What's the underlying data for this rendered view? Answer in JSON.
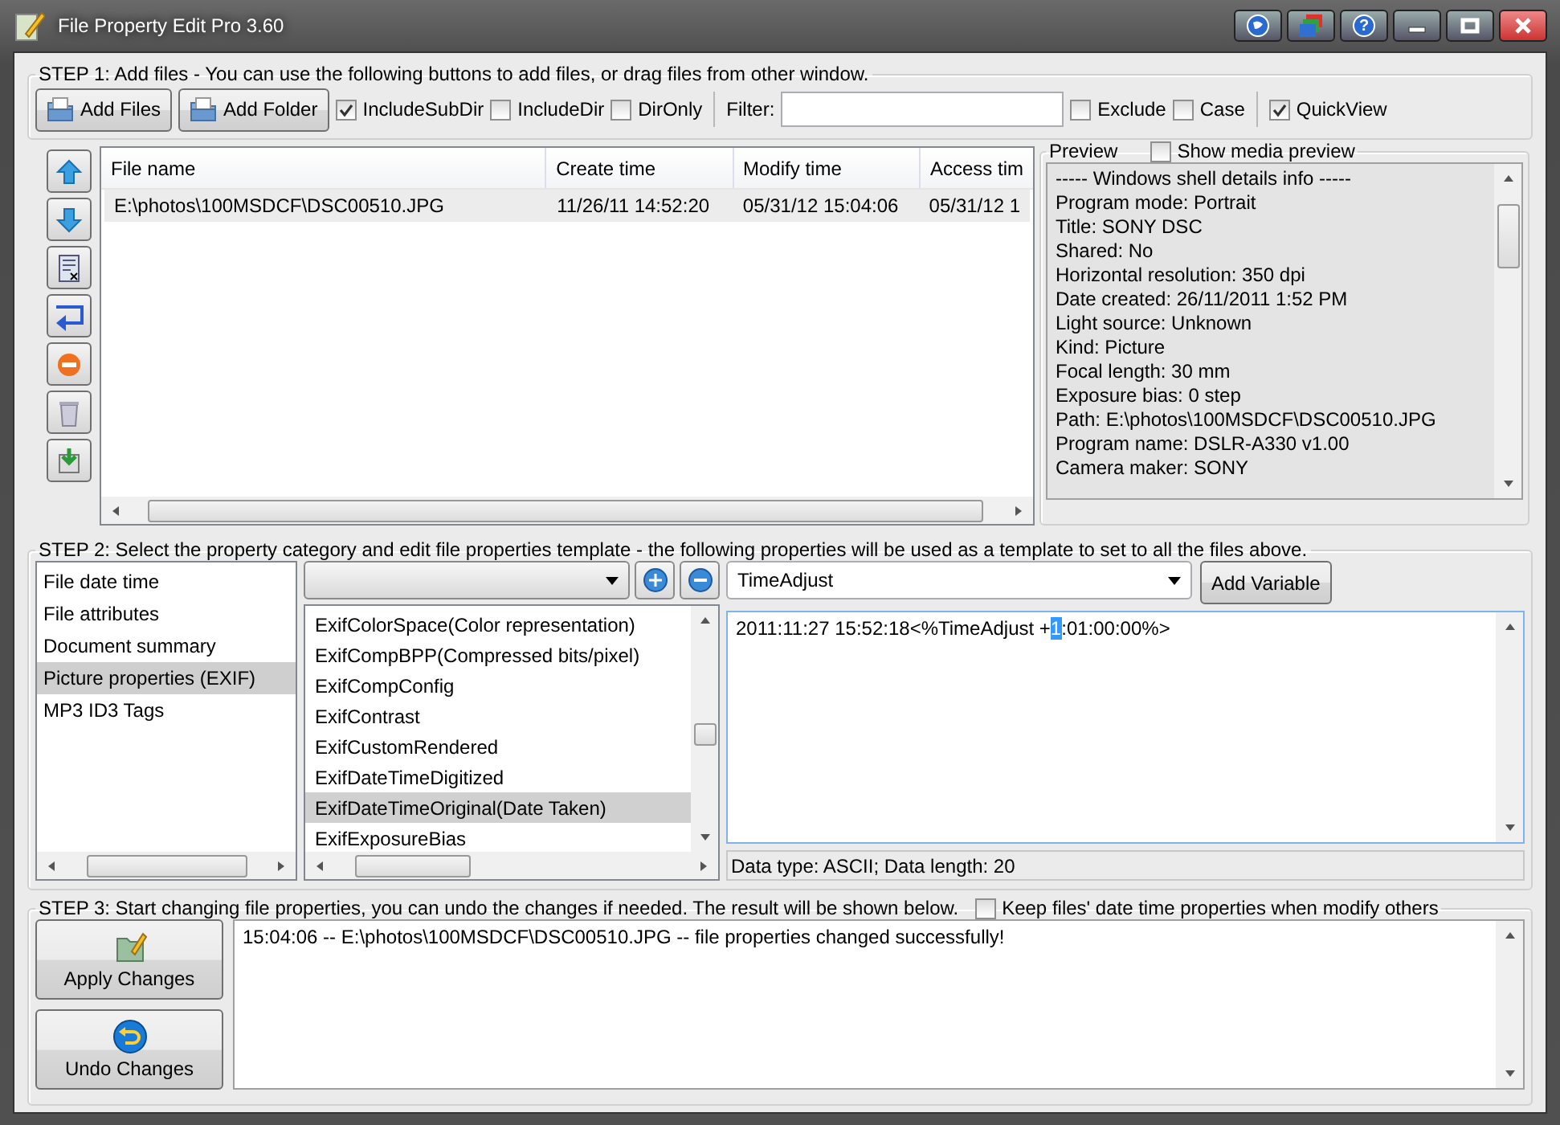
{
  "window": {
    "title": "File Property Edit Pro 3.60",
    "help_glyph": "?"
  },
  "step1": {
    "legend": "STEP 1: Add files - You can use the following buttons to add files, or drag files from other window.",
    "buttons": [
      "Add Files",
      "Add Folder"
    ],
    "options": [
      {
        "label": "IncludeSubDir",
        "checked": true
      },
      {
        "label": "IncludeDir",
        "checked": false
      },
      {
        "label": "DirOnly",
        "checked": false
      }
    ],
    "filter": {
      "label": "Filter:"
    },
    "filter_options": [
      {
        "label": "Exclude",
        "checked": false
      },
      {
        "label": "Case",
        "checked": false
      }
    ],
    "quickview": {
      "label": "QuickView",
      "checked": true
    }
  },
  "files": {
    "columns": [
      "File name",
      "Create time",
      "Modify time",
      "Access tim"
    ],
    "rows": [
      {
        "cells": [
          "E:\\photos\\100MSDCF\\DSC00510.JPG",
          "11/26/11 14:52:20",
          "05/31/12 15:04:06",
          "05/31/12 1"
        ],
        "selected": true
      }
    ]
  },
  "preview": {
    "legend": "Preview",
    "show_media": {
      "label": "Show media preview",
      "checked": false
    },
    "lines": [
      "----- Windows shell details info -----",
      "Program mode: Portrait",
      "Title: SONY DSC",
      "Shared: No",
      "Horizontal resolution: 350 dpi",
      "Date created: 26/11/2011 1:52 PM",
      "Light source: Unknown",
      "Kind: Picture",
      "Focal length: 30 mm",
      "Exposure bias: 0 step",
      "Path: E:\\photos\\100MSDCF\\DSC00510.JPG",
      "Program name: DSLR-A330 v1.00",
      "Camera maker: SONY"
    ]
  },
  "step2": {
    "legend": "STEP 2: Select the property category and edit file properties template - the following properties will be used as a template to set to all the files above.",
    "categories": [
      {
        "label": "File date time",
        "selected": false
      },
      {
        "label": "File attributes",
        "selected": false
      },
      {
        "label": "Document summary",
        "selected": false
      },
      {
        "label": "Picture properties (EXIF)",
        "selected": true
      },
      {
        "label": "MP3 ID3 Tags",
        "selected": false
      }
    ],
    "properties": [
      {
        "label": "ExifColorSpace(Color representation)",
        "selected": false
      },
      {
        "label": "ExifCompBPP(Compressed bits/pixel)",
        "selected": false
      },
      {
        "label": "ExifCompConfig",
        "selected": false
      },
      {
        "label": "ExifContrast",
        "selected": false
      },
      {
        "label": "ExifCustomRendered",
        "selected": false
      },
      {
        "label": "ExifDateTimeDigitized",
        "selected": false
      },
      {
        "label": "ExifDateTimeOriginal(Date Taken)",
        "selected": true
      },
      {
        "label": "ExifExposureBias",
        "selected": false
      }
    ],
    "variable": "TimeAdjust",
    "add_variable": "Add Variable",
    "template": [
      {
        "text": "2011:11:27 15:52:18<%TimeAdjust +",
        "selected": false
      },
      {
        "text": "1",
        "selected": true
      },
      {
        "text": ":01:00:00%>",
        "selected": false
      }
    ],
    "status": "Data type: ASCII; Data length: 20"
  },
  "step3": {
    "legend": "STEP 3: Start changing file properties, you can undo the changes if needed. The result will be shown below.",
    "keep": {
      "label": "Keep files' date time properties when modify others",
      "checked": false
    },
    "buttons": [
      {
        "label": "Apply Changes",
        "kind": "apply"
      },
      {
        "label": "Undo Changes",
        "kind": "undo"
      }
    ],
    "log": [
      "15:04:06 -- E:\\photos\\100MSDCF\\DSC00510.JPG -- file properties changed successfully!"
    ]
  }
}
